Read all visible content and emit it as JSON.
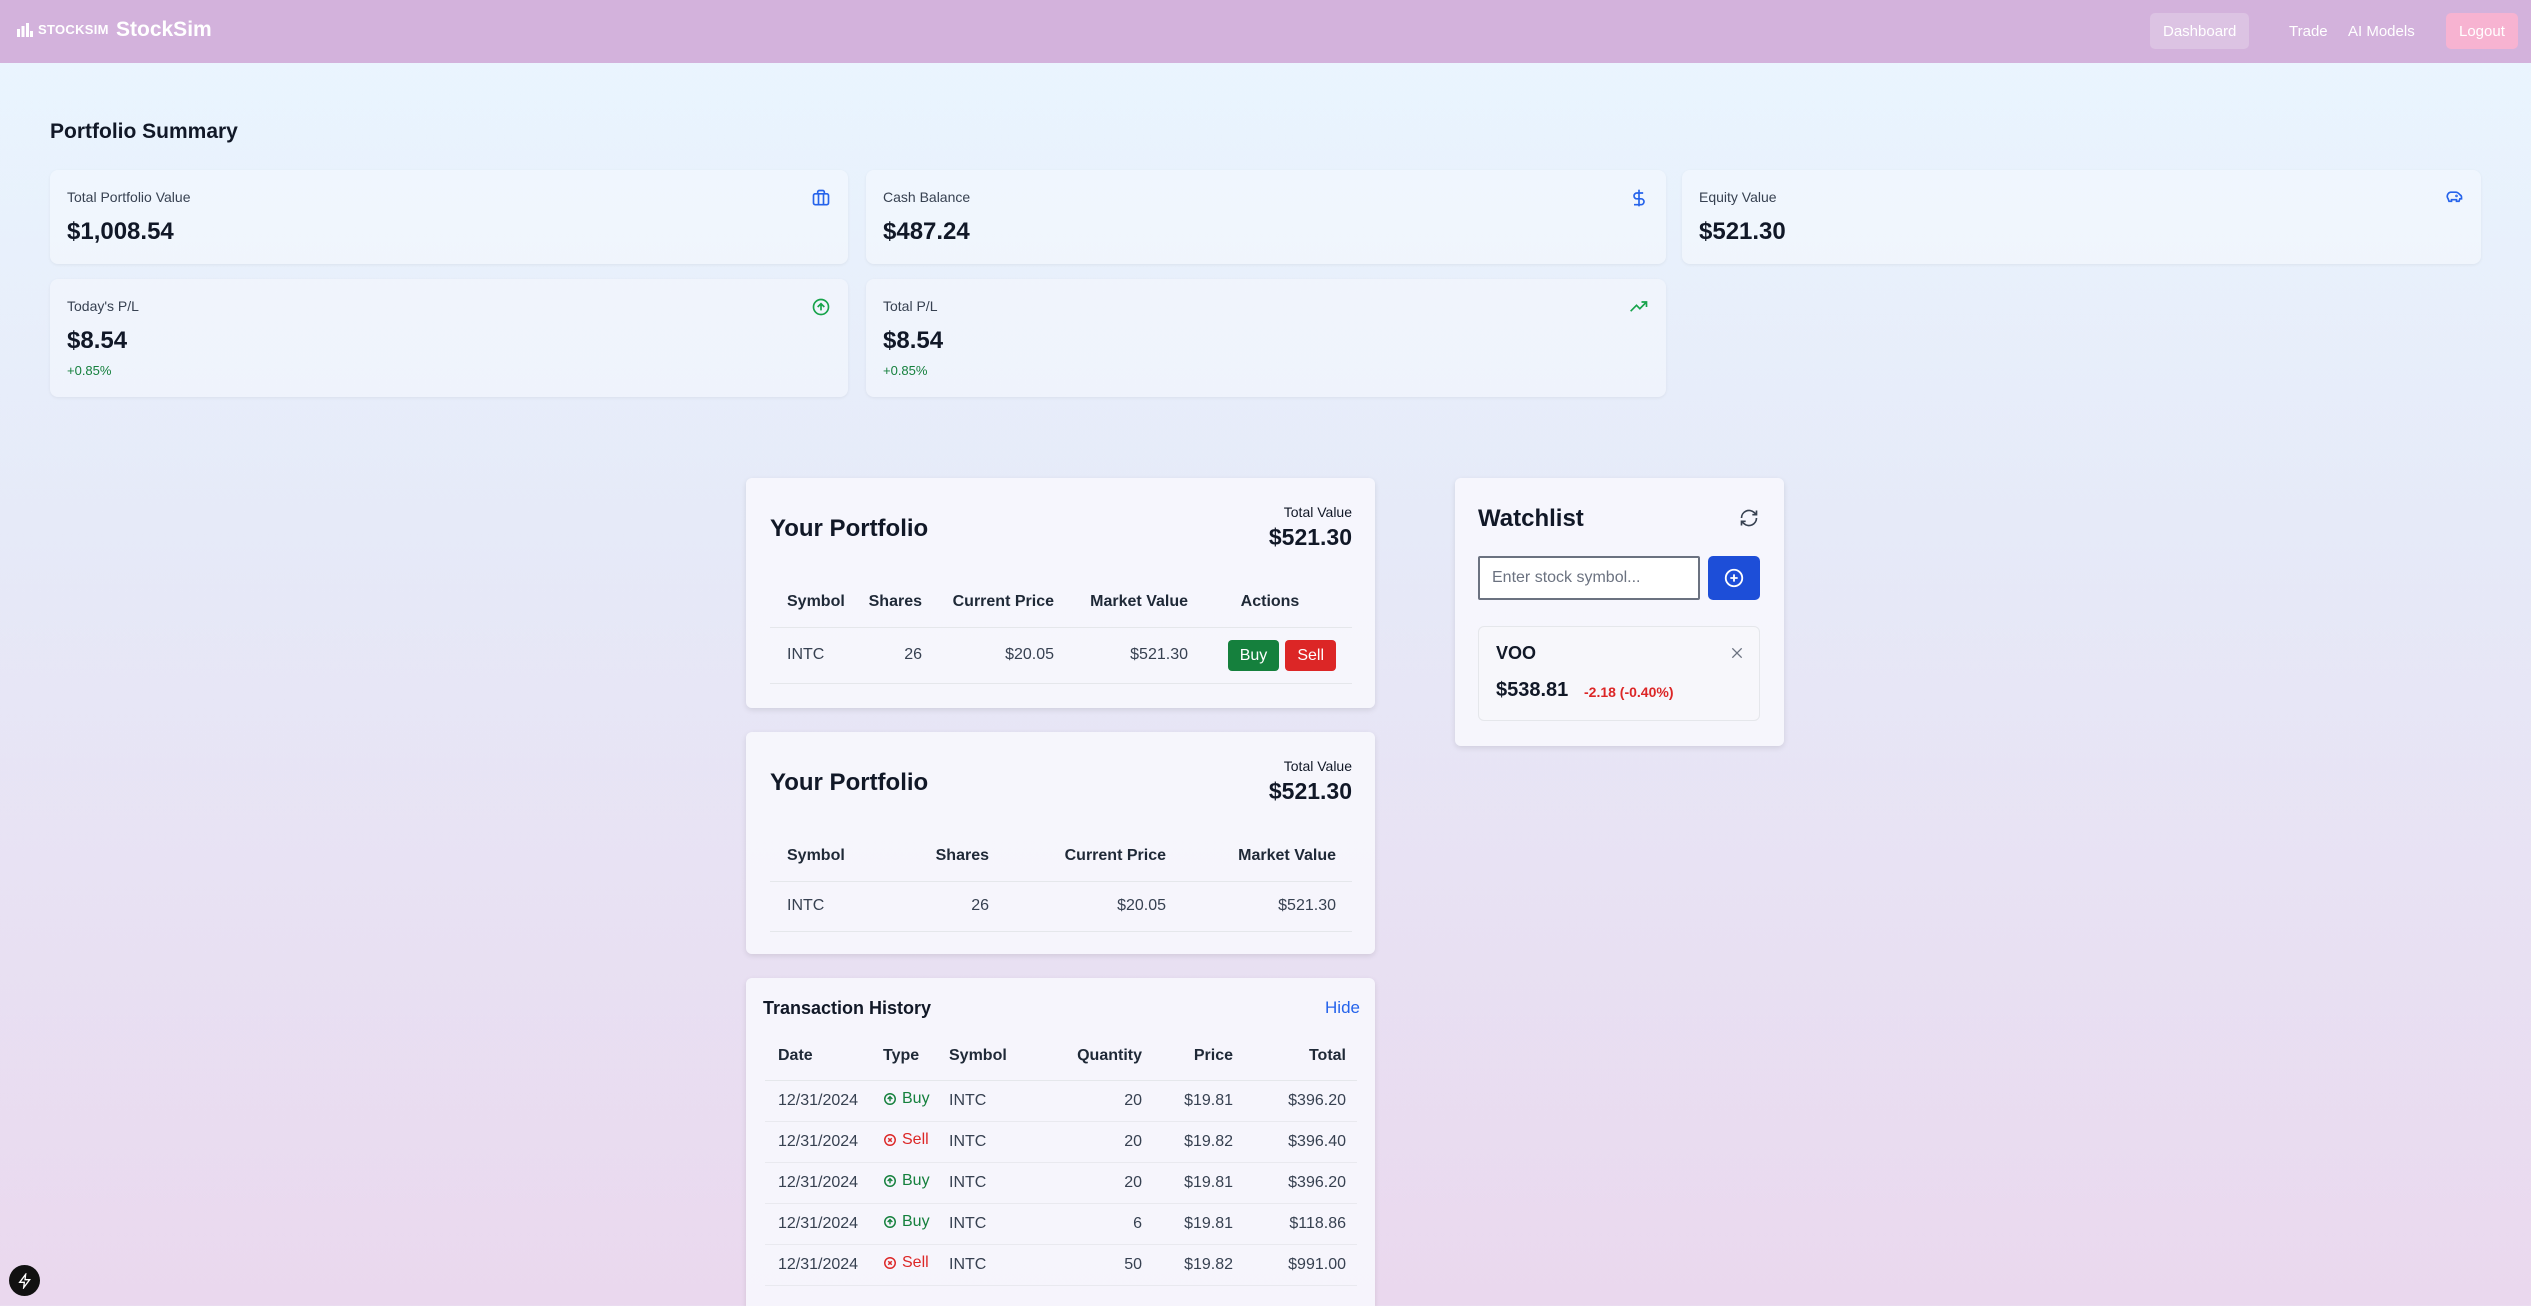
{
  "nav": {
    "logo_text": "STOCKSIM",
    "brand": "StockSim",
    "items": [
      {
        "label": "Dashboard",
        "active": true
      },
      {
        "label": "Trade"
      },
      {
        "label": "AI Models"
      },
      {
        "label": "Logout"
      }
    ]
  },
  "summary": {
    "title": "Portfolio Summary",
    "cards": [
      {
        "label": "Total Portfolio Value",
        "value": "$1,008.54",
        "icon": "briefcase-icon"
      },
      {
        "label": "Cash Balance",
        "value": "$487.24",
        "icon": "dollar-icon"
      },
      {
        "label": "Equity Value",
        "value": "$521.30",
        "icon": "piggy-bank-icon"
      },
      {
        "label": "Today's P/L",
        "value": "$8.54",
        "change": "+0.85%",
        "icon": "arrow-up-circle-icon"
      },
      {
        "label": "Total P/L",
        "value": "$8.54",
        "change": "+0.85%",
        "icon": "trending-up-icon"
      }
    ]
  },
  "portfolio1": {
    "title": "Your Portfolio",
    "total_label": "Total Value",
    "total_value": "$521.30",
    "headers": [
      "Symbol",
      "Shares",
      "Current Price",
      "Market Value",
      "Actions"
    ],
    "rows": [
      {
        "symbol": "INTC",
        "shares": "26",
        "price": "$20.05",
        "market_value": "$521.30",
        "buy": "Buy",
        "sell": "Sell"
      }
    ]
  },
  "portfolio2": {
    "title": "Your Portfolio",
    "total_label": "Total Value",
    "total_value": "$521.30",
    "headers": [
      "Symbol",
      "Shares",
      "Current Price",
      "Market Value"
    ],
    "rows": [
      {
        "symbol": "INTC",
        "shares": "26",
        "price": "$20.05",
        "market_value": "$521.30"
      }
    ]
  },
  "transactions": {
    "title": "Transaction History",
    "toggle": "Hide",
    "headers": [
      "Date",
      "Type",
      "Symbol",
      "Quantity",
      "Price",
      "Total"
    ],
    "rows": [
      {
        "date": "12/31/2024",
        "type": "Buy",
        "symbol": "INTC",
        "quantity": "20",
        "price": "$19.81",
        "total": "$396.20"
      },
      {
        "date": "12/31/2024",
        "type": "Sell",
        "symbol": "INTC",
        "quantity": "20",
        "price": "$19.82",
        "total": "$396.40"
      },
      {
        "date": "12/31/2024",
        "type": "Buy",
        "symbol": "INTC",
        "quantity": "20",
        "price": "$19.81",
        "total": "$396.20"
      },
      {
        "date": "12/31/2024",
        "type": "Buy",
        "symbol": "INTC",
        "quantity": "6",
        "price": "$19.81",
        "total": "$118.86"
      },
      {
        "date": "12/31/2024",
        "type": "Sell",
        "symbol": "INTC",
        "quantity": "50",
        "price": "$19.82",
        "total": "$991.00"
      }
    ]
  },
  "watchlist": {
    "title": "Watchlist",
    "input_placeholder": "Enter stock symbol...",
    "items": [
      {
        "symbol": "VOO",
        "price": "$538.81",
        "change": "-2.18 (-0.40%)"
      }
    ]
  },
  "colors": {
    "nav": "#d3b2dc",
    "buy": "#15803d",
    "sell": "#dc2626",
    "accent": "#1d4ed8",
    "logout": "#f7b3d1"
  }
}
